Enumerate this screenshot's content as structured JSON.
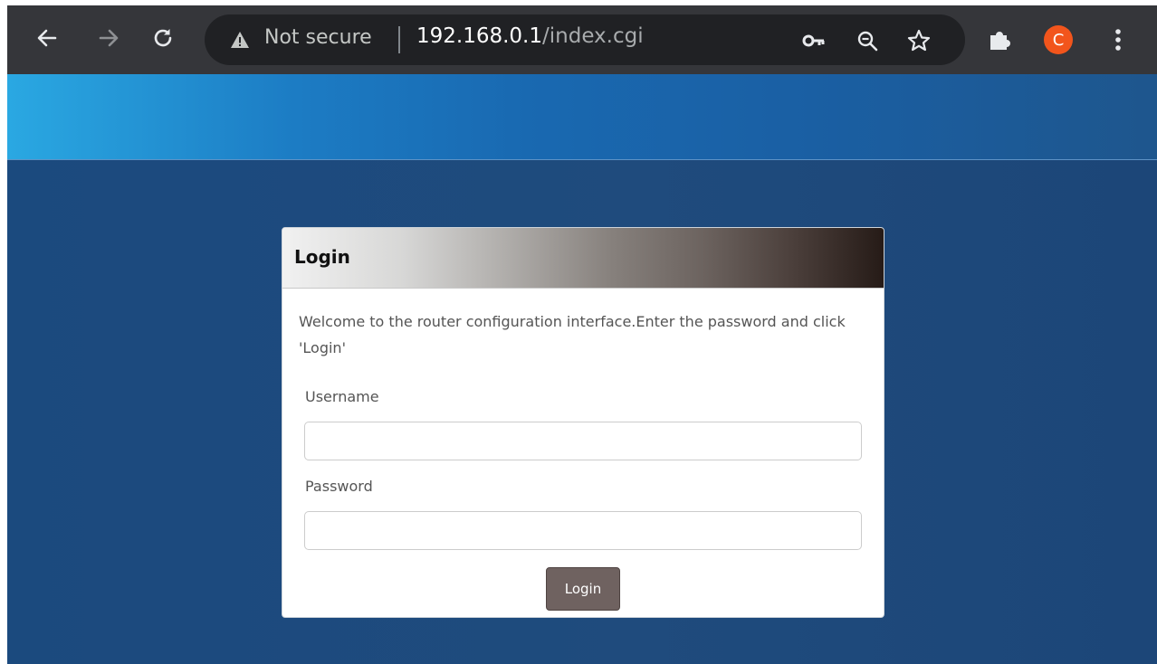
{
  "browser": {
    "security_label": "Not secure",
    "url_host": "192.168.0.1",
    "url_path": "/index.cgi",
    "profile_initial": "C",
    "colors": {
      "toolbar": "#35363a",
      "omnibox": "#202124",
      "avatar": "#f2551c"
    },
    "icons": [
      "back-arrow-icon",
      "forward-arrow-icon",
      "reload-icon",
      "warning-icon",
      "key-icon",
      "zoom-out-icon",
      "star-icon",
      "puzzle-icon",
      "kebab-menu-icon"
    ]
  },
  "login_panel": {
    "title": "Login",
    "welcome_text": "Welcome to the router configuration interface.Enter the password and click 'Login'",
    "username_label": "Username",
    "username_value": "",
    "password_label": "Password",
    "password_value": "",
    "login_button_label": "Login"
  },
  "colors": {
    "page_background": "#1d4a7c",
    "banner_start": "#2aa8e2",
    "banner_end": "#1e568d",
    "header_gradient_start": "#f1f1f1",
    "header_gradient_end": "#261b17",
    "login_button": "#6f6260"
  }
}
